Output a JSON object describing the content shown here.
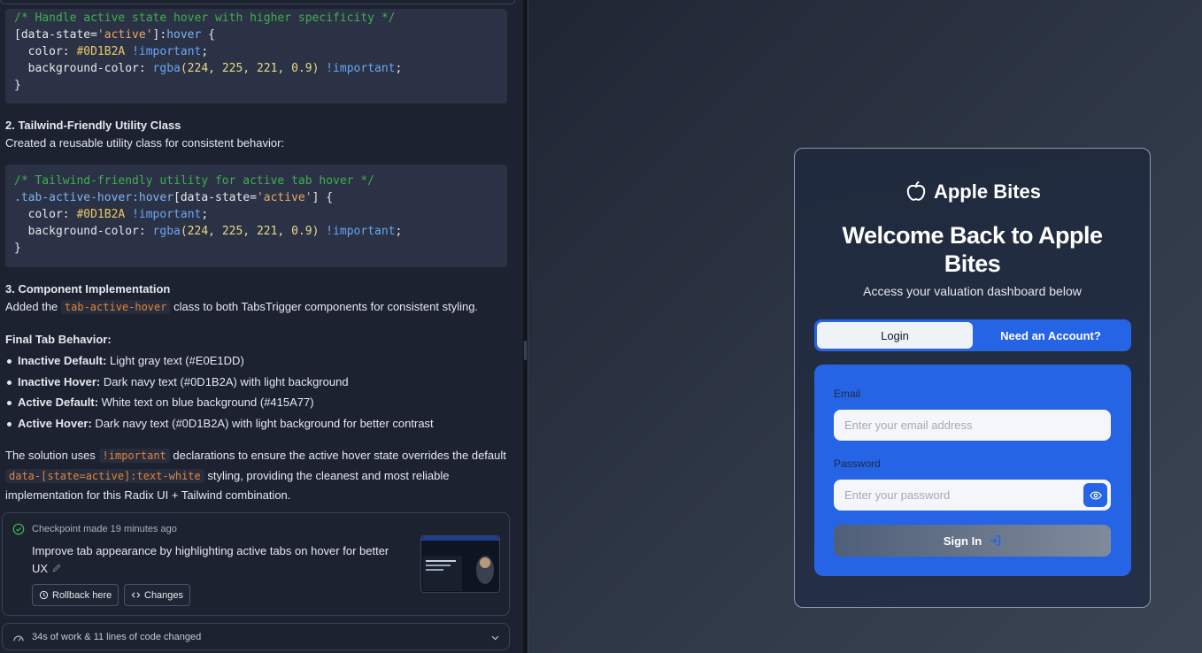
{
  "chat": {
    "code1": {
      "comment": "/* Handle active state hover with higher specificity */",
      "selector_attr": "[data-state=",
      "selector_val": "'active'",
      "selector_end": "]:",
      "pseudo": "hover",
      "brace_open": " {",
      "color_prop": "  color: ",
      "color_val": "#0D1B2A",
      "important": " !important",
      "semi": ";",
      "bg_prop": "  background-color: ",
      "bg_fn": "rgba",
      "bg_args": "(224, 225, 221, 0.9)",
      "brace_close": "}"
    },
    "section2_title": "2. Tailwind-Friendly Utility Class",
    "section2_desc": "Created a reusable utility class for consistent behavior:",
    "code2": {
      "comment": "/* Tailwind-friendly utility for active tab hover */",
      "selector": ".tab-active-hover",
      "pseudo": ":hover",
      "attr": "[data-state=",
      "attr_val": "'active'",
      "attr_end": "] {"
    },
    "section3_title": "3. Component Implementation",
    "section3_pre": "Added the ",
    "section3_code": "tab-active-hover",
    "section3_post": " class to both TabsTrigger components for consistent styling.",
    "final_title": "Final Tab Behavior:",
    "bullets": [
      {
        "bold": "Inactive Default:",
        "text": " Light gray text (#E0E1DD)"
      },
      {
        "bold": "Inactive Hover:",
        "text": " Dark navy text (#0D1B2A) with light background"
      },
      {
        "bold": "Active Default:",
        "text": " White text on blue background (#415A77)"
      },
      {
        "bold": "Active Hover:",
        "text": " Dark navy text (#0D1B2A) with light background for better contrast"
      }
    ],
    "solution_pre": "The solution uses ",
    "solution_code1": "!important",
    "solution_mid": " declarations to ensure the active hover state overrides the default",
    "solution_code2": "data-[state=active]:text-white",
    "solution_mid2": " styling, providing the cleanest and most reliable",
    "solution_end": "implementation for this Radix UI + Tailwind combination.",
    "checkpoint": {
      "meta": "Checkpoint made 19 minutes ago",
      "title": "Improve tab appearance by highlighting active tabs on hover for better UX",
      "rollback": "Rollback here",
      "changes": "Changes"
    },
    "work_summary": "34s of work & 11 lines of code changed"
  },
  "preview": {
    "brand": "Apple Bites",
    "title": "Welcome Back to Apple Bites",
    "subtitle": "Access your valuation dashboard below",
    "tabs": [
      "Login",
      "Need an Account?"
    ],
    "email_label": "Email",
    "email_placeholder": "Enter your email address",
    "password_label": "Password",
    "password_placeholder": "Enter your password",
    "signin": "Sign In"
  },
  "colors": {
    "accent": "#2664e6",
    "panel": "#1c2230"
  }
}
